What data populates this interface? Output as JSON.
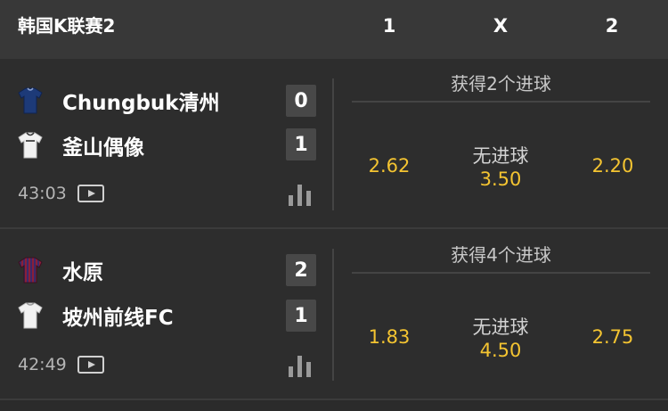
{
  "header": {
    "league": "韩国K联赛2",
    "col_1": "1",
    "col_x": "X",
    "col_2": "2"
  },
  "matches": [
    {
      "home": {
        "name": "Chungbuk清州",
        "score": "0",
        "kit_color": "#1d3a78"
      },
      "away": {
        "name": "釜山偶像",
        "score": "1",
        "kit_color": "#f2f2f2"
      },
      "time": "43:03",
      "market": "获得2个进球",
      "odds": {
        "home": "2.62",
        "draw_label": "无进球",
        "draw": "3.50",
        "away": "2.20"
      }
    },
    {
      "home": {
        "name": "水原",
        "score": "2",
        "kit_color": "#7a2a4a"
      },
      "away": {
        "name": "坡州前线FC",
        "score": "1",
        "kit_color": "#f2f2f2"
      },
      "time": "42:49",
      "market": "获得4个进球",
      "odds": {
        "home": "1.83",
        "draw_label": "无进球",
        "draw": "4.50",
        "away": "2.75"
      }
    }
  ],
  "icons": {
    "play": "play-video-icon",
    "stats": "stats-bars-icon"
  },
  "colors": {
    "odds": "#f4c431",
    "header_bg": "#383838",
    "row_bg": "#2d2d2d"
  }
}
